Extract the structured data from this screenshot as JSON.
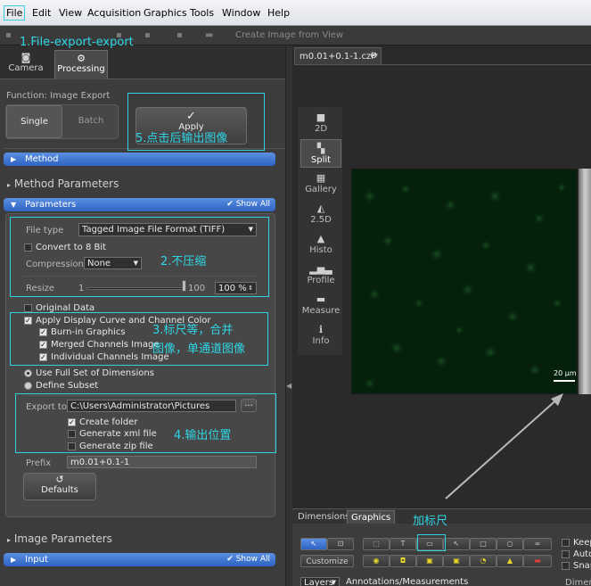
{
  "menu": [
    "File",
    "Edit",
    "View",
    "Acquisition",
    "Graphics",
    "Tools",
    "Window",
    "Help"
  ],
  "toolbar": {
    "create_image": "Create Image from View"
  },
  "left_tabs": [
    {
      "label": "Camera",
      "icon": "camera-icon"
    },
    {
      "label": "Processing",
      "icon": "gear-icon"
    }
  ],
  "function": {
    "label": "Function:",
    "value": "Image Export"
  },
  "mode": {
    "single": "Single",
    "batch": "Batch"
  },
  "apply": {
    "label": "Apply",
    "icon": "✓"
  },
  "method_bar": "Method",
  "method_params_title": "Method Parameters",
  "parameters_bar": {
    "label": "Parameters",
    "show_all": "Show All"
  },
  "file_type": {
    "label": "File type",
    "value": "Tagged Image File Format (TIFF)"
  },
  "convert_8bit": "Convert to 8 Bit",
  "compression": {
    "label": "Compression",
    "value": "None"
  },
  "resize": {
    "label": "Resize",
    "min": "1",
    "max": "100",
    "value": "100 %",
    "fraction": 1.0
  },
  "original_data": "Original Data",
  "display_curve": "Apply Display Curve and Channel Color",
  "burn_in": "Burn-in Graphics",
  "merged": "Merged Channels Image",
  "individual": "Individual Channels Image",
  "use_full": "Use Full Set of Dimensions",
  "define_subset": "Define Subset",
  "export_to": {
    "label": "Export to",
    "value": "C:\\Users\\Administrator\\Pictures",
    "browse": "..."
  },
  "create_folder": "Create folder",
  "gen_xml": "Generate xml file",
  "gen_zip": "Generate zip file",
  "prefix": {
    "label": "Prefix",
    "value": "m0.01+0.1-1"
  },
  "defaults": "Defaults",
  "image_params_title": "Image Parameters",
  "input_bar": {
    "label": "Input",
    "show_all": "Show All"
  },
  "doc_tab": "m0.01+0.1-1.czi*",
  "view_buttons": [
    "2D",
    "Split",
    "Gallery",
    "2.5D",
    "Histo",
    "Profile",
    "Measure",
    "Info"
  ],
  "scale_bar": "20 µm",
  "bottom_tabs": [
    "Dimensions",
    "Graphics"
  ],
  "customize": "Customize",
  "layers": "Layers",
  "annotations": "Annotations/Measurements",
  "dimen_cut": "Dimen",
  "right_checks": [
    "Keep",
    "Auto",
    "Snap"
  ],
  "annotations_overlay": {
    "a1": "1.File-export-export",
    "a5": "5.点击后输出图像",
    "a2": "2.不压缩",
    "a3_line1": "3.标尺等，合并",
    "a3_line2": "图像，单通道图像",
    "a4": "4.输出位置",
    "a6": "加标尺"
  },
  "colors": {
    "accent_blue": "#3d74d6",
    "annotation": "#2fd2e0",
    "image_bg": "#05200b"
  }
}
